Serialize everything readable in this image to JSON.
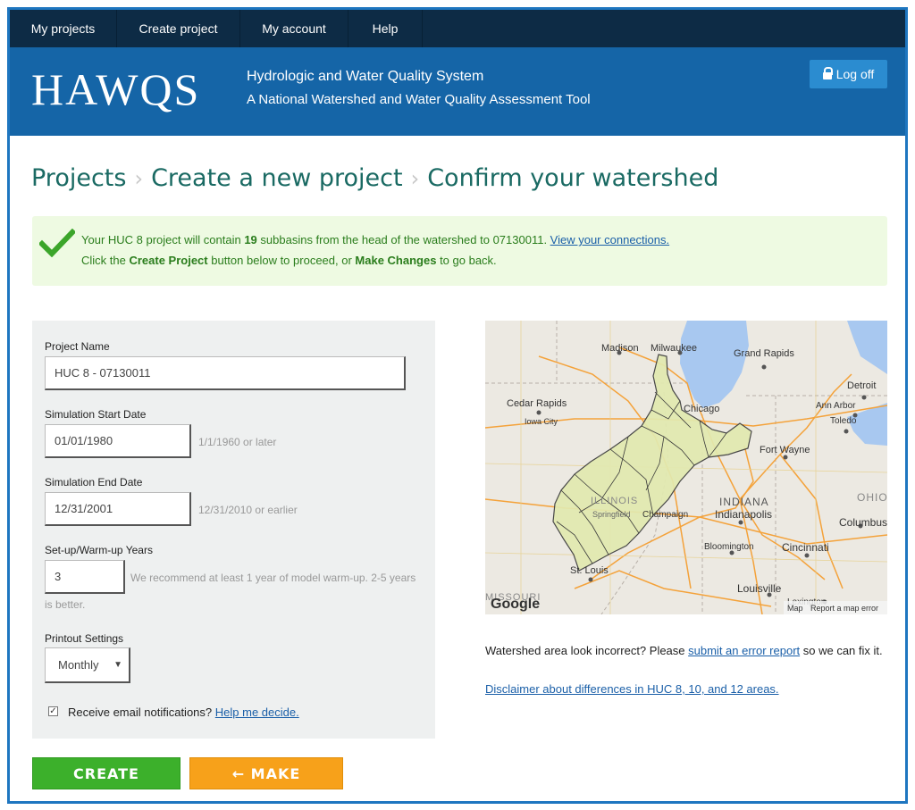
{
  "nav": {
    "items": [
      "My projects",
      "Create project",
      "My account",
      "Help"
    ]
  },
  "header": {
    "logo": "HAWQS",
    "tagline1": "Hydrologic and Water Quality System",
    "tagline2": "A National Watershed and Water Quality Assessment Tool",
    "logoff_label": "Log off"
  },
  "breadcrumb": {
    "items": [
      "Projects",
      "Create a new project",
      "Confirm your watershed"
    ],
    "separator": "›"
  },
  "alert": {
    "line1_pre": "Your HUC 8 project will contain ",
    "subbasins": "19",
    "line1_post": " subbasins from the head of the watershed to 07130011. ",
    "line1_link": "View your connections.",
    "line2_pre": "Click the ",
    "line2_b1": "Create Project",
    "line2_mid": " button below to proceed, or ",
    "line2_b2": "Make Changes",
    "line2_post": " to go back."
  },
  "form": {
    "project_name_label": "Project Name",
    "project_name_value": "HUC 8 - 07130011",
    "start_label": "Simulation Start Date",
    "start_value": "01/01/1980",
    "start_hint": "1/1/1960 or later",
    "end_label": "Simulation End Date",
    "end_value": "12/31/2001",
    "end_hint": "12/31/2010 or earlier",
    "warmup_label": "Set-up/Warm-up Years",
    "warmup_value": "3",
    "warmup_hint_1": "We recommend at least 1 year of model warm-up. 2-5 years",
    "warmup_hint_2": "is better.",
    "printout_label": "Printout Settings",
    "printout_value": "Monthly",
    "email_checked": true,
    "email_label": "Receive email notifications?",
    "email_help": "Help me decide."
  },
  "map": {
    "cities": [
      "Madison",
      "Milwaukee",
      "Grand Rapids",
      "Detroit",
      "Cedar Rapids",
      "Iowa City",
      "Chicago",
      "Ann Arbor",
      "Toledo",
      "Fort Wayne",
      "ILLINOIS",
      "Springfield",
      "Champaign",
      "INDIANA",
      "Indianapolis",
      "OHIO",
      "Columbus",
      "Bloomington",
      "Cincinnati",
      "St. Louis",
      "Louisville",
      "Lexington",
      "MISSOURI"
    ],
    "logo": "Google",
    "footer": "Map",
    "report": "Report a map error",
    "watershed_color": "#e2eab0"
  },
  "map_note": {
    "pre": "Watershed area look incorrect? Please ",
    "link": "submit an error report",
    "post": " so we can fix it.",
    "disclaimer": "Disclaimer about differences in HUC 8, 10, and 12 areas."
  },
  "buttons": {
    "create": "CREATE PROJECT",
    "changes": "MAKE CHANGES",
    "changes_arrow": "←"
  }
}
